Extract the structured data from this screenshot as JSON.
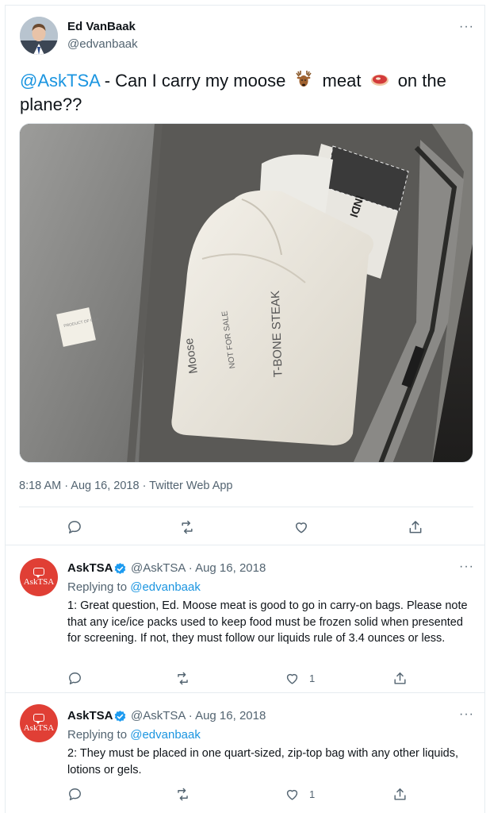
{
  "main_tweet": {
    "author_name": "Ed VanBaak",
    "author_handle": "@edvanbaak",
    "text_mention": "@AskTSA",
    "text_part1": " - Can I carry my moose ",
    "text_part2": " meat ",
    "text_part3": " on the plane??",
    "emoji_1": "deer-emoji",
    "emoji_2": "steak-emoji",
    "timestamp": "8:18 AM · Aug 16, 2018 · Twitter Web App",
    "photo_labels": {
      "bag_left": "Moose",
      "bag_left_sub": "NOT FOR SALE",
      "bag_right": "T-BONE STEAK",
      "package_top": "INDI"
    },
    "actions": [
      "reply-icon",
      "retweet-icon",
      "like-icon",
      "share-icon"
    ]
  },
  "replies": [
    {
      "name": "AskTSA",
      "handle_date": "@AskTSA · Aug 16, 2018",
      "replying_label": "Replying to ",
      "replying_to": "@edvanbaak",
      "body": "1: Great question, Ed. Moose meat is good to go in carry-on bags. Please note that any ice/ice packs used to keep food must be frozen solid when presented for screening. If not, they must follow our liquids rule of 3.4 ounces or less.",
      "like_count": "1",
      "avatar_text": "AskTSA"
    },
    {
      "name": "AskTSA",
      "handle_date": "@AskTSA · Aug 16, 2018",
      "replying_label": "Replying to ",
      "replying_to": "@edvanbaak",
      "body": "2: They must be placed in one quart-sized, zip-top bag with any other liquids, lotions or gels.",
      "like_count": "1",
      "avatar_text": "AskTSA"
    }
  ],
  "colors": {
    "link": "#1b95e0",
    "secondary_text": "#536471",
    "verified": "#1d9bf0",
    "tsa_avatar": "#e03f35"
  },
  "more_label": "···"
}
